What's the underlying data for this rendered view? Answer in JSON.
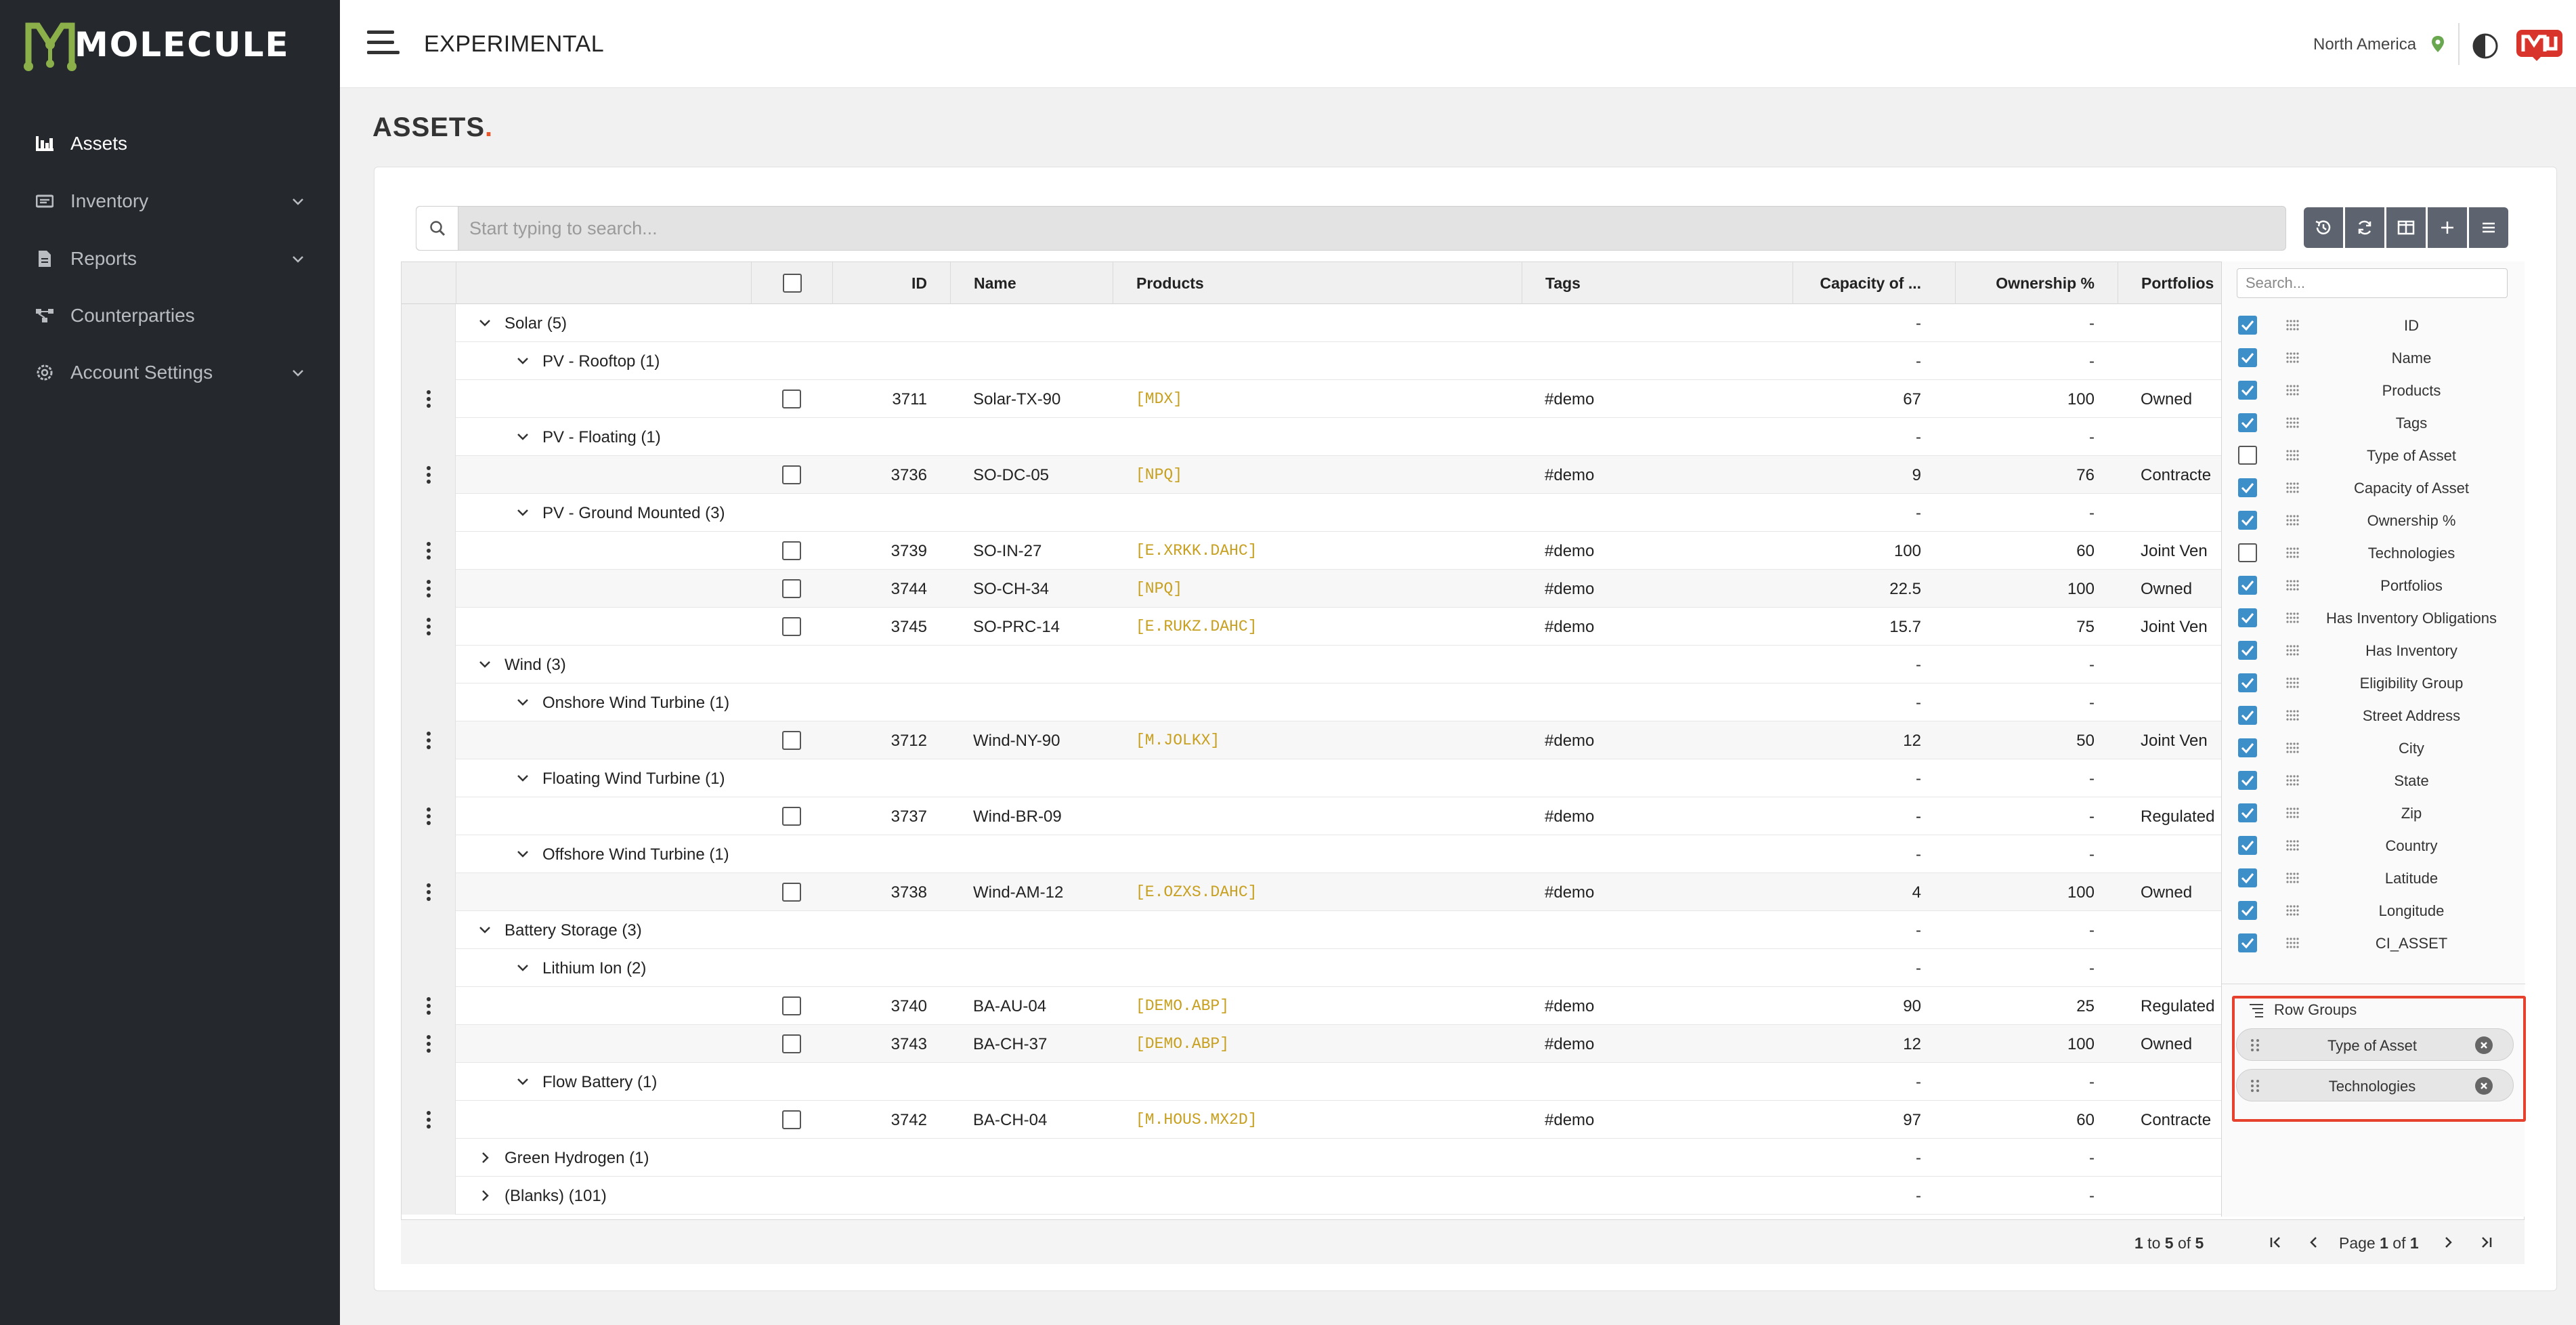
{
  "brand": {
    "name": "MOLECULE"
  },
  "sidebar": {
    "items": [
      {
        "label": "Assets",
        "icon": "assets-icon",
        "active": true
      },
      {
        "label": "Inventory",
        "icon": "inventory-icon",
        "expandable": true
      },
      {
        "label": "Reports",
        "icon": "reports-icon",
        "expandable": true
      },
      {
        "label": "Counterparties",
        "icon": "counterparties-icon"
      },
      {
        "label": "Account Settings",
        "icon": "gear-icon",
        "expandable": true
      }
    ]
  },
  "header": {
    "app_title": "EXPERIMENTAL",
    "region": "North America"
  },
  "page": {
    "title": "ASSETS",
    "title_dot": "."
  },
  "search": {
    "placeholder": "Start typing to search..."
  },
  "grid": {
    "columns": [
      "ID",
      "Name",
      "Products",
      "Tags",
      "Capacity of ...",
      "Ownership %",
      "Portfolios"
    ],
    "rows": [
      {
        "kind": "group",
        "level": 1,
        "expanded": true,
        "label": "Solar (5)",
        "capacity": "-",
        "ownership": "-"
      },
      {
        "kind": "group",
        "level": 2,
        "expanded": true,
        "label": "PV - Rooftop (1)",
        "capacity": "-",
        "ownership": "-"
      },
      {
        "kind": "leaf",
        "id": "3711",
        "name": "Solar-TX-90",
        "products": "[MDX]",
        "tags": "#demo",
        "capacity": "67",
        "ownership": "100",
        "portfolio": "Owned"
      },
      {
        "kind": "group",
        "level": 2,
        "expanded": true,
        "label": "PV - Floating (1)",
        "capacity": "-",
        "ownership": "-"
      },
      {
        "kind": "leaf",
        "id": "3736",
        "name": "SO-DC-05",
        "products": "[NPQ]",
        "tags": "#demo",
        "capacity": "9",
        "ownership": "76",
        "portfolio": "Contracte"
      },
      {
        "kind": "group",
        "level": 2,
        "expanded": true,
        "label": "PV - Ground Mounted (3)",
        "capacity": "-",
        "ownership": "-"
      },
      {
        "kind": "leaf",
        "id": "3739",
        "name": "SO-IN-27",
        "products": "[E.XRKK.DAHC]",
        "tags": "#demo",
        "capacity": "100",
        "ownership": "60",
        "portfolio": "Joint Ven"
      },
      {
        "kind": "leaf",
        "id": "3744",
        "name": "SO-CH-34",
        "products": "[NPQ]",
        "tags": "#demo",
        "capacity": "22.5",
        "ownership": "100",
        "portfolio": "Owned"
      },
      {
        "kind": "leaf",
        "id": "3745",
        "name": "SO-PRC-14",
        "products": "[E.RUKZ.DAHC]",
        "tags": "#demo",
        "capacity": "15.7",
        "ownership": "75",
        "portfolio": "Joint Ven"
      },
      {
        "kind": "group",
        "level": 1,
        "expanded": true,
        "label": "Wind (3)",
        "capacity": "-",
        "ownership": "-"
      },
      {
        "kind": "group",
        "level": 2,
        "expanded": true,
        "label": "Onshore Wind Turbine (1)",
        "capacity": "-",
        "ownership": "-"
      },
      {
        "kind": "leaf",
        "id": "3712",
        "name": "Wind-NY-90",
        "products": "[M.JOLKX]",
        "tags": "#demo",
        "capacity": "12",
        "ownership": "50",
        "portfolio": "Joint Ven"
      },
      {
        "kind": "group",
        "level": 2,
        "expanded": true,
        "label": "Floating Wind Turbine (1)",
        "capacity": "-",
        "ownership": "-"
      },
      {
        "kind": "leaf",
        "id": "3737",
        "name": "Wind-BR-09",
        "products": "",
        "tags": "#demo",
        "capacity": "-",
        "ownership": "-",
        "portfolio": "Regulated"
      },
      {
        "kind": "group",
        "level": 2,
        "expanded": true,
        "label": "Offshore Wind Turbine (1)",
        "capacity": "-",
        "ownership": "-"
      },
      {
        "kind": "leaf",
        "id": "3738",
        "name": "Wind-AM-12",
        "products": "[E.OZXS.DAHC]",
        "tags": "#demo",
        "capacity": "4",
        "ownership": "100",
        "portfolio": "Owned"
      },
      {
        "kind": "group",
        "level": 1,
        "expanded": true,
        "label": "Battery Storage (3)",
        "capacity": "-",
        "ownership": "-"
      },
      {
        "kind": "group",
        "level": 2,
        "expanded": true,
        "label": "Lithium Ion (2)",
        "capacity": "-",
        "ownership": "-"
      },
      {
        "kind": "leaf",
        "id": "3740",
        "name": "BA-AU-04",
        "products": "[DEMO.ABP]",
        "tags": "#demo",
        "capacity": "90",
        "ownership": "25",
        "portfolio": "Regulated"
      },
      {
        "kind": "leaf",
        "id": "3743",
        "name": "BA-CH-37",
        "products": "[DEMO.ABP]",
        "tags": "#demo",
        "capacity": "12",
        "ownership": "100",
        "portfolio": "Owned"
      },
      {
        "kind": "group",
        "level": 2,
        "expanded": true,
        "label": "Flow Battery (1)",
        "capacity": "-",
        "ownership": "-"
      },
      {
        "kind": "leaf",
        "id": "3742",
        "name": "BA-CH-04",
        "products": "[M.HOUS.MX2D]",
        "tags": "#demo",
        "capacity": "97",
        "ownership": "60",
        "portfolio": "Contracte"
      },
      {
        "kind": "group",
        "level": 1,
        "expanded": false,
        "label": "Green Hydrogen (1)",
        "capacity": "-",
        "ownership": "-"
      },
      {
        "kind": "group",
        "level": 1,
        "expanded": false,
        "label": "(Blanks) (101)",
        "capacity": "-",
        "ownership": "-"
      }
    ]
  },
  "column_panel": {
    "search_placeholder": "Search...",
    "columns": [
      {
        "label": "ID",
        "checked": true
      },
      {
        "label": "Name",
        "checked": true
      },
      {
        "label": "Products",
        "checked": true
      },
      {
        "label": "Tags",
        "checked": true
      },
      {
        "label": "Type of Asset",
        "checked": false
      },
      {
        "label": "Capacity of Asset",
        "checked": true
      },
      {
        "label": "Ownership %",
        "checked": true
      },
      {
        "label": "Technologies",
        "checked": false
      },
      {
        "label": "Portfolios",
        "checked": true
      },
      {
        "label": "Has Inventory Obligations",
        "checked": true
      },
      {
        "label": "Has Inventory",
        "checked": true
      },
      {
        "label": "Eligibility Group",
        "checked": true
      },
      {
        "label": "Street Address",
        "checked": true
      },
      {
        "label": "City",
        "checked": true
      },
      {
        "label": "State",
        "checked": true
      },
      {
        "label": "Zip",
        "checked": true
      },
      {
        "label": "Country",
        "checked": true
      },
      {
        "label": "Latitude",
        "checked": true
      },
      {
        "label": "Longitude",
        "checked": true
      },
      {
        "label": "CI_ASSET",
        "checked": true
      }
    ],
    "row_groups_title": "Row Groups",
    "row_groups": [
      "Type of Asset",
      "Technologies"
    ]
  },
  "pager": {
    "from": "1",
    "to": "5",
    "total": "5",
    "page": "1",
    "pages": "1"
  },
  "colors": {
    "accent": "#e8572a",
    "checkbox": "#3d8fc9",
    "brand_green": "#8bb04a",
    "product": "#c8a020",
    "highlight_box": "#e5412d",
    "sidebar_bg": "#25282d"
  }
}
